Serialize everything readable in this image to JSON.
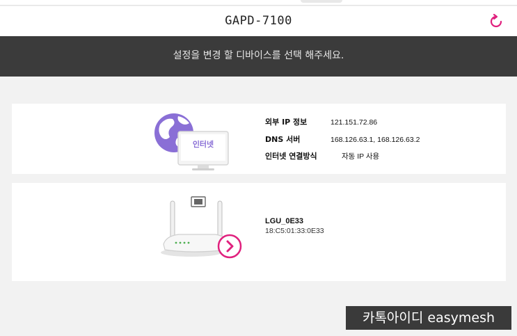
{
  "header": {
    "title": "GAPD-7100",
    "refresh_icon": "refresh-icon"
  },
  "banner": {
    "text": "설정을 변경 할 디바이스를 선택 해주세요."
  },
  "internet": {
    "monitor_label": "인터넷",
    "rows": [
      {
        "label": "외부 IP 정보",
        "value": "121.151.72.86"
      },
      {
        "label": "DNS 서버",
        "value": "168.126.63.1, 168.126.63.2"
      },
      {
        "label": "인터넷 연결방식",
        "value": "자동 IP 사용"
      }
    ]
  },
  "router": {
    "name": "LGU_0E33",
    "mac": "18:C5:01:33:0E33"
  },
  "watermark": {
    "text": "카톡아이디 easymesh"
  },
  "colors": {
    "accent": "#e0217e",
    "banner": "#3b3b3b",
    "globe": "#8a6fd6"
  }
}
